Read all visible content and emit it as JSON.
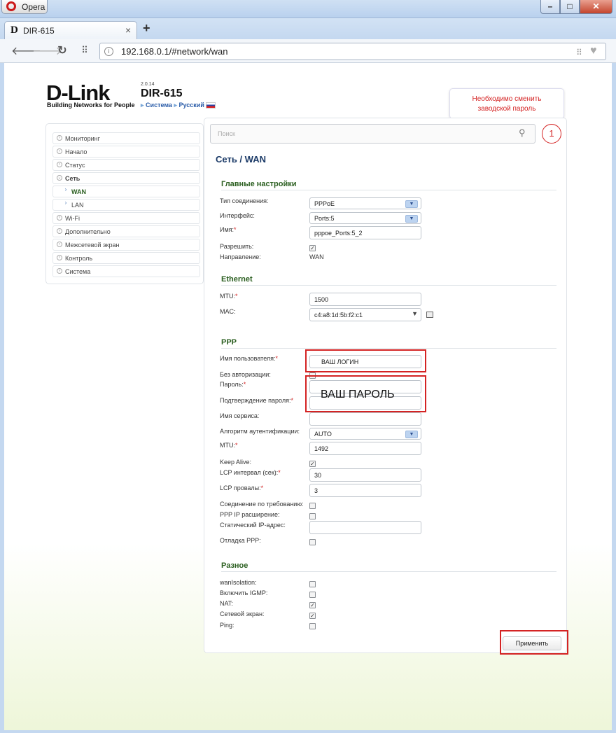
{
  "browser": {
    "menu_label": "Opera",
    "tab_title": "DIR-615",
    "tab_favicon": "D",
    "url": "192.168.0.1/#network/wan",
    "controls": {
      "minimize": "–",
      "maximize": "□",
      "close": "✕"
    }
  },
  "header": {
    "logo": "D-Link",
    "logo_tagline": "Building Networks for People",
    "firmware": "2.0.14",
    "model": "DIR-615",
    "crumb_system": "Система",
    "crumb_language": "Русский"
  },
  "alert": {
    "line1": "Необходимо сменить",
    "line2": "заводской пароль"
  },
  "search": {
    "placeholder": "Поиск"
  },
  "notifications": {
    "count": "1"
  },
  "sidebar": {
    "items": [
      {
        "label": "Мониторинг"
      },
      {
        "label": "Начало"
      },
      {
        "label": "Статус"
      },
      {
        "label": "Сеть"
      },
      {
        "label": "WAN"
      },
      {
        "label": "LAN"
      },
      {
        "label": "Wi-Fi"
      },
      {
        "label": "Дополнительно"
      },
      {
        "label": "Межсетевой экран"
      },
      {
        "label": "Контроль"
      },
      {
        "label": "Система"
      }
    ]
  },
  "page": {
    "title": "Сеть /  WAN"
  },
  "main_settings": {
    "title": "Главные настройки",
    "conn_type_label": "Тип соединения:",
    "conn_type_value": "PPPoE",
    "interface_label": "Интерфейс:",
    "interface_value": "Ports:5",
    "name_label": "Имя:",
    "name_value": "pppoe_Ports:5_2",
    "enable_label": "Разрешить:",
    "direction_label": "Направление:",
    "direction_value": "WAN"
  },
  "ethernet": {
    "title": "Ethernet",
    "mtu_label": "MTU:",
    "mtu_value": "1500",
    "mac_label": "MAC:",
    "mac_value": "c4:a8:1d:5b:f2:c1"
  },
  "ppp": {
    "title": "PPP",
    "username_label": "Имя пользователя:",
    "username_value": "ВАШ ЛОГИН",
    "no_auth_label": "Без авторизации:",
    "password_label": "Пароль:",
    "password_confirm_label": "Подтверждение пароля:",
    "password_overlay": "ВАШ ПАРОЛЬ",
    "service_label": "Имя сервиса:",
    "auth_algo_label": "Алгоритм аутентификации:",
    "auth_algo_value": "AUTO",
    "mtu_label": "MTU:",
    "mtu_value": "1492",
    "keepalive_label": "Keep Alive:",
    "lcp_interval_label": "LCP интервал (сек):",
    "lcp_interval_value": "30",
    "lcp_fails_label": "LCP провалы:",
    "lcp_fails_value": "3",
    "on_demand_label": "Соединение по требованию:",
    "ip_ext_label": "PPP IP расширение:",
    "static_ip_label": "Статический IP-адрес:",
    "debug_label": "Отладка PPP:"
  },
  "misc": {
    "title": "Разное",
    "wan_isolation_label": "wanIsolation:",
    "igmp_label": "Включить IGMP:",
    "nat_label": "NAT:",
    "firewall_label": "Сетевой экран:",
    "ping_label": "Ping:"
  },
  "actions": {
    "apply_label": "Применить"
  },
  "colors": {
    "accent_red": "#d42323",
    "section_green": "#2a5e1f",
    "title_blue": "#1b3a67"
  }
}
